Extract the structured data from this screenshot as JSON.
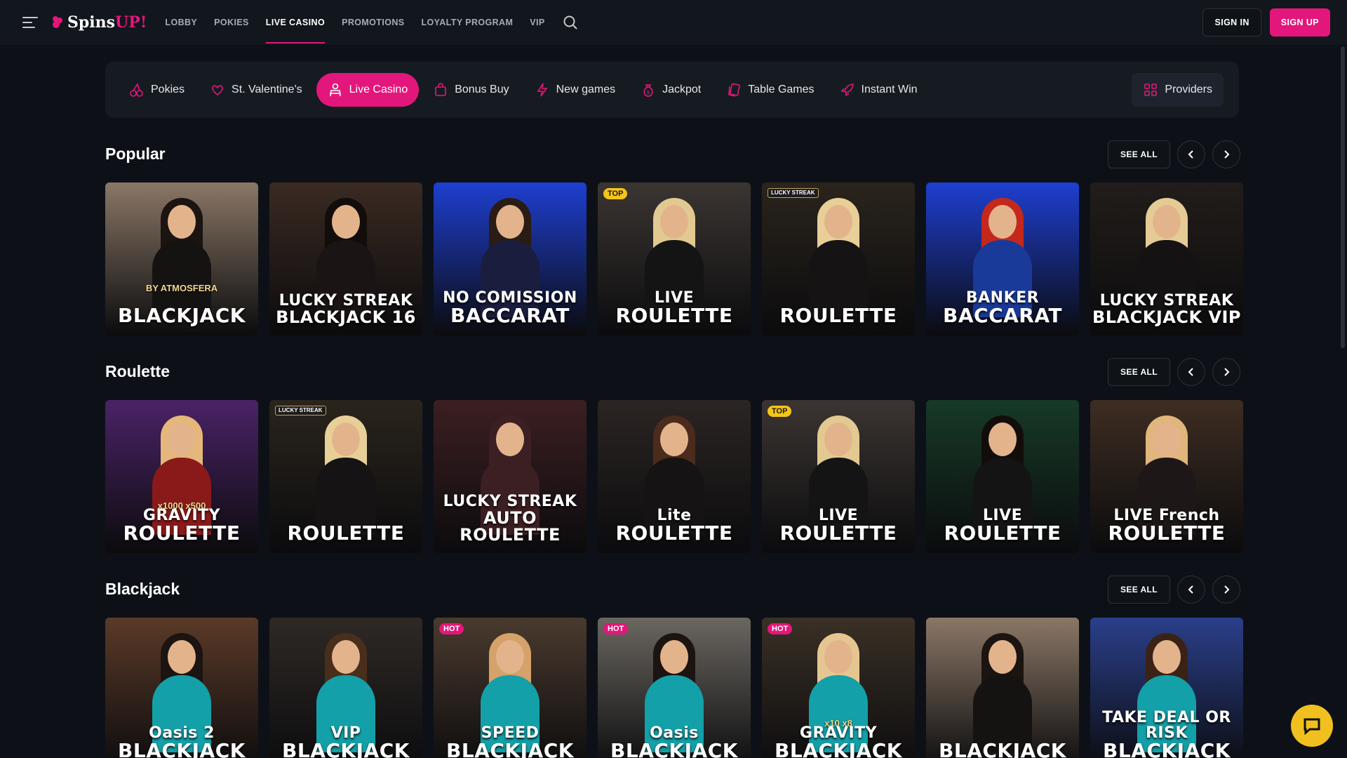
{
  "header": {
    "logo_text": "Spins",
    "logo_accent": "UP!",
    "nav": [
      "LOBBY",
      "POKIES",
      "LIVE CASINO",
      "PROMOTIONS",
      "LOYALTY PROGRAM",
      "VIP"
    ],
    "active_nav": "LIVE CASINO",
    "sign_in": "SIGN IN",
    "sign_up": "SIGN UP"
  },
  "categories": [
    {
      "label": "Pokies",
      "icon": "cherries-icon"
    },
    {
      "label": "St. Valentine's",
      "icon": "heart-gift-icon"
    },
    {
      "label": "Live Casino",
      "icon": "dealer-icon",
      "active": true
    },
    {
      "label": "Bonus Buy",
      "icon": "bag-icon"
    },
    {
      "label": "New games",
      "icon": "lightning-icon"
    },
    {
      "label": "Jackpot",
      "icon": "money-bag-icon"
    },
    {
      "label": "Table Games",
      "icon": "cards-icon"
    },
    {
      "label": "Instant Win",
      "icon": "rocket-icon"
    }
  ],
  "providers_label": "Providers",
  "see_all": "SEE ALL",
  "sections": [
    {
      "title": "Popular",
      "cards": [
        {
          "line1": "",
          "line2": "BLACKJACK",
          "sub": "BY ATMOSFERA",
          "badge": "",
          "bg": "#8a7766",
          "hair": "#1b1410",
          "body": "#151212"
        },
        {
          "line1": "LUCKY STREAK",
          "line2": "BLACKJACK 16",
          "sub": "",
          "badge": "",
          "bg": "#3a2a22",
          "hair": "#120d0b",
          "body": "#1a1414"
        },
        {
          "line1": "NO COMISSION",
          "line2": "BACCARAT",
          "sub": "",
          "badge": "",
          "bg": "#1e3fd0",
          "hair": "#2a1c15",
          "body": "#1b1d3e"
        },
        {
          "line1": "LIVE",
          "line2": "ROULETTE",
          "sub": "",
          "badge": "TOP",
          "bg": "#3b3532",
          "hair": "#e2c991",
          "body": "#141414"
        },
        {
          "line1": "",
          "line2": "ROULETTE",
          "sub": "",
          "badge": "LUCKY STREAK",
          "bg": "#2a241c",
          "hair": "#e8cf98",
          "body": "#151313"
        },
        {
          "line1": "BANKER",
          "line2": "BACCARAT",
          "sub": "",
          "badge": "",
          "bg": "#1e3fd0",
          "hair": "#c4281c",
          "body": "#1a3a9a"
        },
        {
          "line1": "LUCKY STREAK",
          "line2": "BLACKJACK VIP",
          "sub": "",
          "badge": "",
          "bg": "#221d1a",
          "hair": "#e4cb95",
          "body": "#141212"
        }
      ]
    },
    {
      "title": "Roulette",
      "cards": [
        {
          "line1": "GRAVITY",
          "line2": "ROULETTE",
          "sub": "x1000  x500",
          "badge": "",
          "bg": "#4a2366",
          "hair": "#e6b77a",
          "body": "#8a1a1a"
        },
        {
          "line1": "",
          "line2": "ROULETTE",
          "sub": "",
          "badge": "LUCKY STREAK",
          "bg": "#2a241c",
          "hair": "#e8cf98",
          "body": "#151313"
        },
        {
          "line1": "LUCKY STREAK",
          "line2": "AUTO ROULETTE",
          "sub": "",
          "badge": "",
          "bg": "#3c1f22",
          "hair": "#3c1f22",
          "body": "#3c1f22"
        },
        {
          "line1": "Lite",
          "line2": "ROULETTE",
          "sub": "",
          "badge": "",
          "bg": "#2b2523",
          "hair": "#4a2b1c",
          "body": "#151313"
        },
        {
          "line1": "LIVE",
          "line2": "ROULETTE",
          "sub": "",
          "badge": "TOP",
          "bg": "#3b3532",
          "hair": "#e2c991",
          "body": "#141414"
        },
        {
          "line1": "LIVE",
          "line2": "ROULETTE",
          "sub": "",
          "badge": "",
          "bg": "#173a27",
          "hair": "#120d0b",
          "body": "#141414"
        },
        {
          "line1": "LIVE  French",
          "line2": "ROULETTE",
          "sub": "",
          "badge": "",
          "bg": "#3e2d22",
          "hair": "#e0b67c",
          "body": "#1d1717"
        }
      ]
    },
    {
      "title": "Blackjack",
      "cards": [
        {
          "line1": "Oasis 2",
          "line2": "BLACKJACK",
          "sub": "",
          "badge": "",
          "bg": "#5a3a28",
          "hair": "#1b1410",
          "body": "#14a0a8"
        },
        {
          "line1": "VIP",
          "line2": "BLACKJACK",
          "sub": "",
          "badge": "",
          "bg": "#2e2925",
          "hair": "#4a2e1c",
          "body": "#14a0a8"
        },
        {
          "line1": "SPEED",
          "line2": "BLACKJACK",
          "sub": "",
          "badge": "HOT",
          "bg": "#4a3a2e",
          "hair": "#d4a26a",
          "body": "#14a0a8"
        },
        {
          "line1": "Oasis",
          "line2": "BLACKJACK",
          "sub": "",
          "badge": "HOT",
          "bg": "#6a6660",
          "hair": "#1b1410",
          "body": "#14a0a8"
        },
        {
          "line1": "GRAVITY",
          "line2": "BLACKJACK",
          "sub": "x10  x8",
          "badge": "HOT",
          "bg": "#3a3026",
          "hair": "#e6c690",
          "body": "#14a0a8"
        },
        {
          "line1": "",
          "line2": "BLACKJACK",
          "sub": "",
          "badge": "",
          "bg": "#8a7766",
          "hair": "#1b1410",
          "body": "#151212"
        },
        {
          "line1": "TAKE DEAL OR RISK",
          "line2": "BLACKJACK",
          "sub": "",
          "badge": "",
          "bg": "#2a3f8a",
          "hair": "#3a2316",
          "body": "#14a0a8"
        }
      ]
    }
  ],
  "colors": {
    "accent": "#e3177b",
    "bg": "#0d1117",
    "panel": "#161b22",
    "chat": "#f2c01e"
  }
}
